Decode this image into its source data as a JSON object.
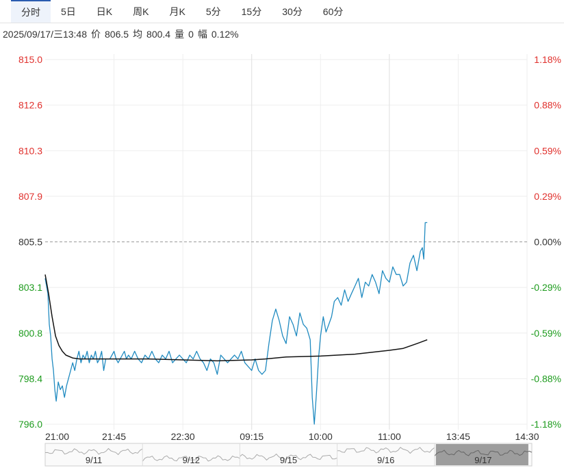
{
  "tabs": [
    {
      "label": "分时",
      "active": true
    },
    {
      "label": "5日",
      "active": false
    },
    {
      "label": "日K",
      "active": false
    },
    {
      "label": "周K",
      "active": false
    },
    {
      "label": "月K",
      "active": false
    },
    {
      "label": "5分",
      "active": false
    },
    {
      "label": "15分",
      "active": false
    },
    {
      "label": "30分",
      "active": false
    },
    {
      "label": "60分",
      "active": false
    }
  ],
  "info": {
    "datetime": "2025/09/17/三13:48",
    "price_label": "价",
    "price": "806.5",
    "avg_label": "均",
    "avg": "800.4",
    "volume_label": "量",
    "volume": "0",
    "change_label": "幅",
    "change": "0.12%"
  },
  "colors": {
    "up": "#e0302c",
    "down": "#1d9b1d",
    "price_line": "#1f8ac0",
    "avg_line": "#111111",
    "grid": "#eeeeee",
    "ref_line": "#999999"
  },
  "chart_data": {
    "type": "line",
    "ylim": [
      796.0,
      815.0
    ],
    "ref_price": 805.5,
    "y_ticks_left": [
      "815.0",
      "812.6",
      "810.3",
      "807.9",
      "805.5",
      "803.1",
      "800.8",
      "798.4",
      "796.0"
    ],
    "y_ticks_right": [
      "1.18%",
      "0.88%",
      "0.59%",
      "0.29%",
      "0.00%",
      "-0.29%",
      "-0.59%",
      "-0.88%",
      "-1.18%"
    ],
    "x_ticks": [
      "21:00",
      "21:45",
      "22:30",
      "09:15",
      "10:00",
      "11:00",
      "13:45",
      "14:30"
    ],
    "session_breaks": [
      3,
      5
    ],
    "last_index": 5.55,
    "series": [
      {
        "role": "price",
        "x": [
          0,
          0.04,
          0.06,
          0.08,
          0.1,
          0.12,
          0.14,
          0.16,
          0.19,
          0.22,
          0.25,
          0.28,
          0.31,
          0.34,
          0.37,
          0.4,
          0.43,
          0.46,
          0.49,
          0.52,
          0.55,
          0.58,
          0.61,
          0.64,
          0.67,
          0.7,
          0.73,
          0.76,
          0.79,
          0.82,
          0.85,
          0.88,
          0.91,
          0.94,
          0.97,
          1.0,
          1.03,
          1.06,
          1.09,
          1.12,
          1.15,
          1.18,
          1.21,
          1.25,
          1.3,
          1.35,
          1.4,
          1.45,
          1.5,
          1.55,
          1.6,
          1.65,
          1.7,
          1.75,
          1.8,
          1.85,
          1.9,
          1.95,
          2.0,
          2.05,
          2.1,
          2.15,
          2.2,
          2.25,
          2.3,
          2.35,
          2.4,
          2.45,
          2.5,
          2.55,
          2.6,
          2.65,
          2.7,
          2.75,
          2.8,
          2.85,
          2.9,
          2.95,
          3.0,
          3.05,
          3.1,
          3.15,
          3.2,
          3.25,
          3.3,
          3.35,
          3.4,
          3.45,
          3.5,
          3.55,
          3.6,
          3.65,
          3.7,
          3.75,
          3.8,
          3.85,
          3.88,
          3.91,
          3.94,
          3.97,
          4.0,
          4.04,
          4.08,
          4.12,
          4.16,
          4.2,
          4.25,
          4.3,
          4.35,
          4.4,
          4.45,
          4.5,
          4.55,
          4.6,
          4.65,
          4.7,
          4.75,
          4.8,
          4.85,
          4.9,
          4.95,
          5.0,
          5.05,
          5.1,
          5.15,
          5.2,
          5.25,
          5.3,
          5.35,
          5.4,
          5.45,
          5.48,
          5.5,
          5.52,
          5.55
        ],
        "y": [
          803.6,
          802.8,
          801.2,
          800.6,
          799.4,
          798.8,
          797.8,
          797.2,
          798.2,
          797.8,
          798.0,
          797.4,
          798.0,
          798.4,
          798.8,
          799.2,
          798.8,
          799.4,
          799.8,
          799.2,
          799.6,
          799.4,
          799.8,
          799.2,
          799.6,
          799.4,
          799.8,
          799.2,
          799.4,
          799.8,
          798.8,
          799.4,
          799.4,
          799.4,
          799.6,
          799.8,
          799.4,
          799.2,
          799.4,
          799.6,
          799.8,
          799.4,
          799.6,
          799.4,
          799.8,
          799.4,
          799.2,
          799.6,
          799.4,
          799.8,
          799.4,
          799.2,
          799.6,
          799.4,
          799.8,
          799.2,
          799.4,
          799.6,
          799.4,
          799.2,
          799.6,
          799.4,
          799.8,
          799.4,
          799.2,
          798.8,
          799.4,
          799.2,
          798.6,
          799.6,
          799.4,
          799.2,
          799.4,
          799.6,
          799.4,
          799.8,
          799.2,
          799.0,
          798.8,
          799.4,
          798.8,
          798.6,
          798.8,
          800.2,
          801.4,
          802.0,
          801.4,
          800.6,
          800.2,
          801.6,
          801.2,
          800.6,
          801.8,
          801.2,
          801.0,
          800.4,
          797.4,
          796.0,
          797.6,
          799.4,
          800.6,
          801.6,
          800.8,
          801.2,
          801.6,
          802.4,
          802.6,
          802.2,
          803.0,
          802.4,
          802.8,
          803.2,
          803.6,
          802.6,
          803.4,
          803.2,
          803.8,
          803.4,
          802.8,
          804.0,
          803.6,
          803.4,
          804.2,
          803.8,
          803.8,
          803.2,
          803.4,
          804.4,
          804.8,
          804.0,
          805.0,
          805.2,
          804.6,
          806.5,
          806.5
        ]
      },
      {
        "role": "average",
        "x": [
          0,
          0.05,
          0.1,
          0.15,
          0.2,
          0.25,
          0.3,
          0.4,
          0.5,
          0.6,
          0.8,
          1.0,
          1.5,
          2.0,
          2.5,
          3.0,
          3.2,
          3.5,
          4.0,
          4.5,
          5.0,
          5.2,
          5.4,
          5.55
        ],
        "y": [
          803.8,
          802.8,
          801.6,
          800.6,
          800.1,
          799.8,
          799.6,
          799.45,
          799.4,
          799.4,
          799.4,
          799.4,
          799.4,
          799.35,
          799.3,
          799.35,
          799.4,
          799.5,
          799.55,
          799.65,
          799.85,
          799.95,
          800.2,
          800.4
        ]
      }
    ]
  },
  "navigator": {
    "dates": [
      "9/11",
      "9/12",
      "9/15",
      "9/16",
      "9/17"
    ]
  }
}
